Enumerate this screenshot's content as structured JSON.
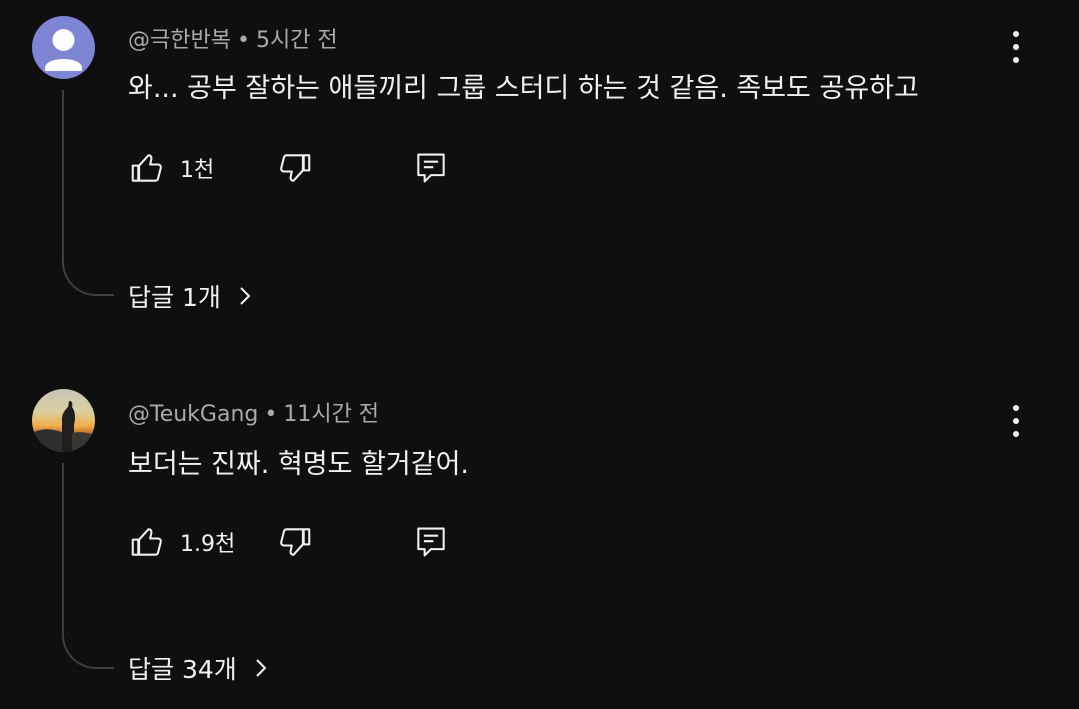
{
  "comments": [
    {
      "author": "@극한반복",
      "separator": "•",
      "time": "5시간 전",
      "text": "와... 공부 잘하는 애들끼리 그룹 스터디 하는 것 같음. 족보도 공유하고",
      "likes": "1천",
      "replies": "답글 1개",
      "avatar_color": "#7d85d4"
    },
    {
      "author": "@TeukGang",
      "separator": "•",
      "time": "11시간 전",
      "text": "보더는 진짜. 혁명도 할거같어.",
      "likes": "1.9천",
      "replies": "답글 34개"
    }
  ],
  "icons": {
    "like": "thumb-up-icon",
    "dislike": "thumb-down-icon",
    "reply": "comment-icon",
    "more": "more-vertical-icon",
    "chevron": "chevron-right-icon"
  }
}
